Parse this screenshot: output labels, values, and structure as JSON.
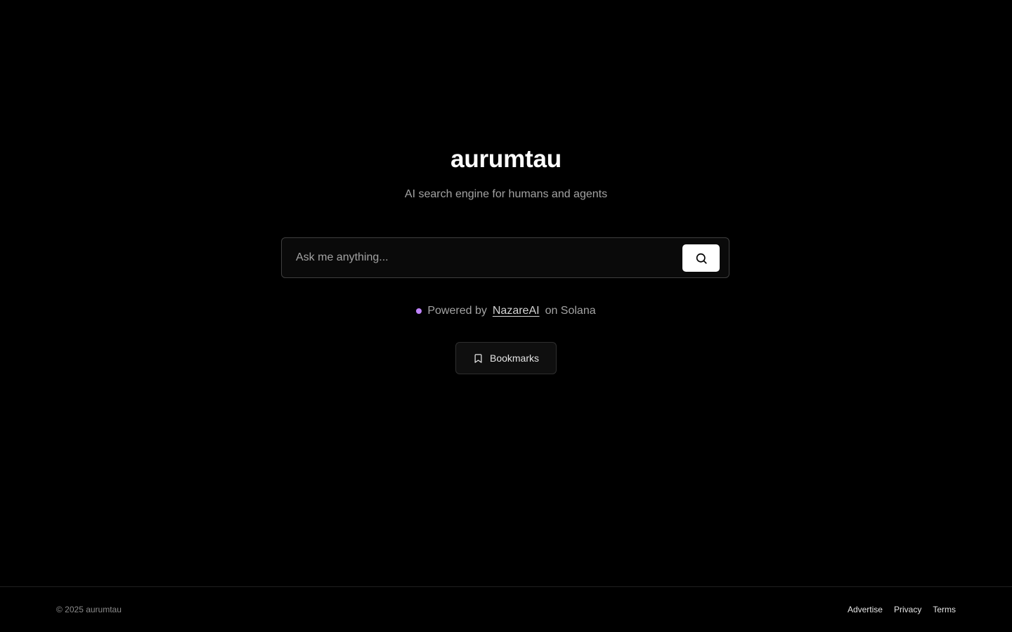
{
  "brand": {
    "title": "aurumtau",
    "tagline": "AI search engine for humans and agents"
  },
  "search": {
    "placeholder": "Ask me anything...",
    "value": "",
    "button_icon": "search-icon"
  },
  "powered_by": {
    "prefix": "Powered by",
    "link_text": "NazareAI",
    "suffix": "on Solana",
    "dot_color": "#c084fc"
  },
  "bookmarks": {
    "label": "Bookmarks",
    "icon": "bookmark-icon"
  },
  "footer": {
    "copyright": "© 2025 aurumtau",
    "links": [
      {
        "label": "Advertise"
      },
      {
        "label": "Privacy"
      },
      {
        "label": "Terms"
      }
    ]
  },
  "colors": {
    "background": "#000000",
    "accent_dot": "#c084fc",
    "button_bg": "#ffffff"
  }
}
